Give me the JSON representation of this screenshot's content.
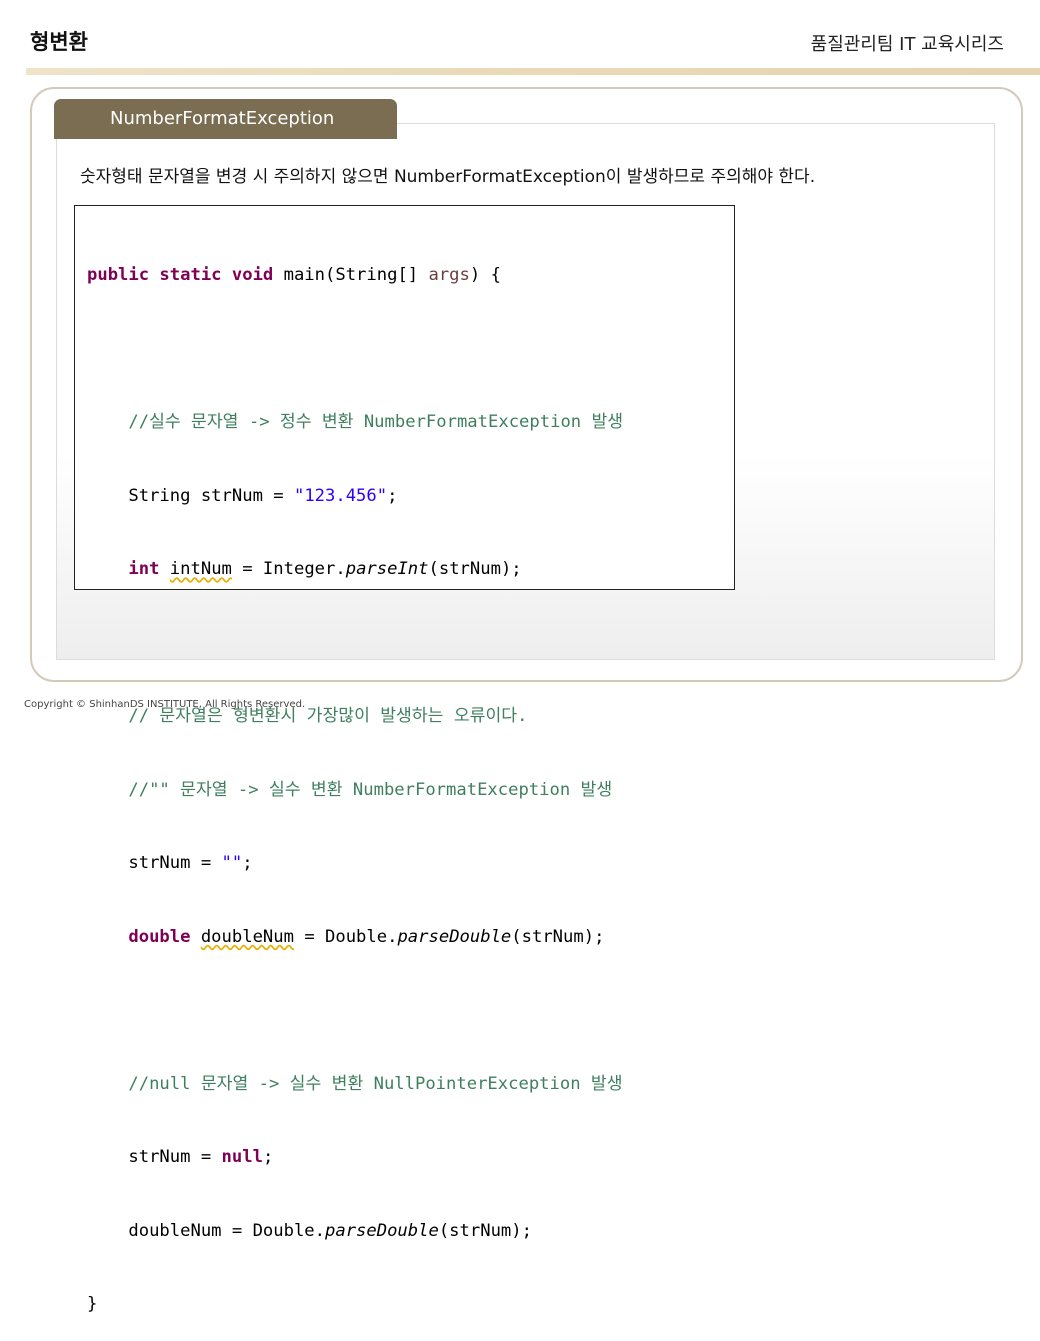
{
  "header": {
    "title": "형변환",
    "series": "품질관리팀 IT 교육시리즈"
  },
  "slide": {
    "tab_label": "NumberFormatException",
    "description": "숫자형태 문자열을 변경 시 주의하지 않으면 NumberFormatException이 발생하므로 주의해야 한다."
  },
  "code": {
    "l1_kw": "public static void",
    "l1_rest": " main(String[] ",
    "l1_arg": "args",
    "l1_end": ") {",
    "l3_comment": "    //실수 문자열 -> 정수 변환 NumberFormatException 발생",
    "l4_pre": "    String strNum = ",
    "l4_str": "\"123.456\"",
    "l4_end": ";",
    "l5_kw": "    int ",
    "l5_var": "intNum",
    "l5_mid": " = Integer.",
    "l5_method": "parseInt",
    "l5_end": "(strNum);",
    "l7_comment": "    // 문자열은 형변환시 가장많이 발생하는 오류이다.",
    "l8_comment": "    //\"\" 문자열 -> 실수 변환 NumberFormatException 발생",
    "l9_pre": "    strNum = ",
    "l9_str": "\"\"",
    "l9_end": ";",
    "l10_kw": "    double ",
    "l10_var": "doubleNum",
    "l10_mid": " = Double.",
    "l10_method": "parseDouble",
    "l10_end": "(strNum);",
    "l12_comment": "    //null 문자열 -> 실수 변환 NullPointerException 발생",
    "l13_pre": "    strNum = ",
    "l13_kw": "null",
    "l13_end": ";",
    "l14_pre": "    doubleNum = Double.",
    "l14_method": "parseDouble",
    "l14_end": "(strNum);",
    "l15": "}"
  },
  "footer": {
    "copyright": "Copyright © ShinhanDS INSTITUTE, All Rights Reserved."
  }
}
